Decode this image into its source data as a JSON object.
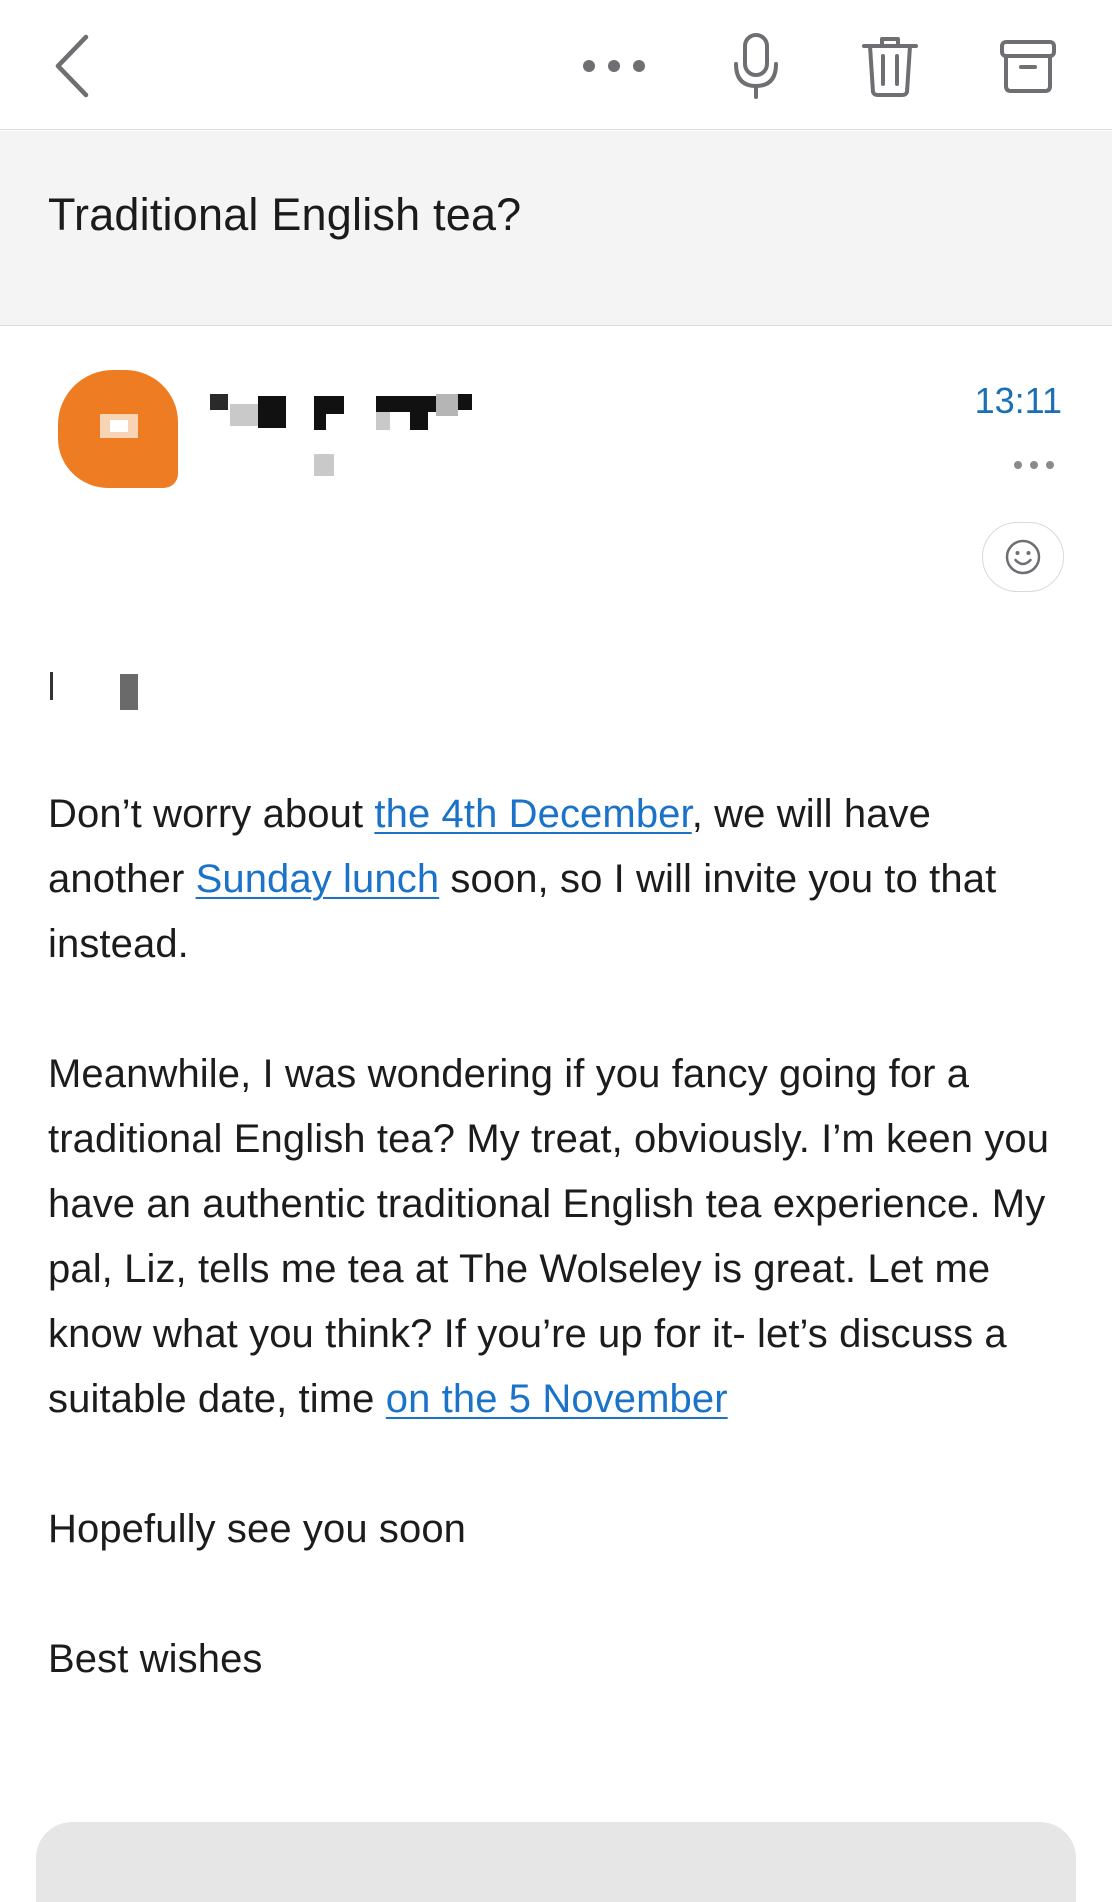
{
  "toolbar": {
    "icons": [
      "back-chevron-icon",
      "more-options-icon",
      "microphone-icon",
      "trash-icon",
      "archive-icon"
    ]
  },
  "email": {
    "subject": "Traditional English tea?",
    "time": "13:11",
    "body": {
      "p1": {
        "t1": "Don’t worry about ",
        "link1": "the 4th December",
        "t2": ", we will have another ",
        "link2": "Sunday lunch",
        "t3": " soon, so I will invite you to that instead."
      },
      "p2": {
        "t1": "Meanwhile, I was wondering if you fancy going for a traditional English tea? My treat, obviously.  I’m keen you have an authentic traditional English tea experience.  My pal, Liz,  tells me tea at The Wolseley is great. Let me know what you think? If you’re up for it- let’s discuss a suitable date, time ",
        "link1": "on the 5 November"
      },
      "p3": "Hopefully see you soon",
      "p4": "Best wishes"
    }
  },
  "colors": {
    "accent": "#1a73c8",
    "avatar": "#ee7c22",
    "subject_bg": "#f4f4f5"
  }
}
